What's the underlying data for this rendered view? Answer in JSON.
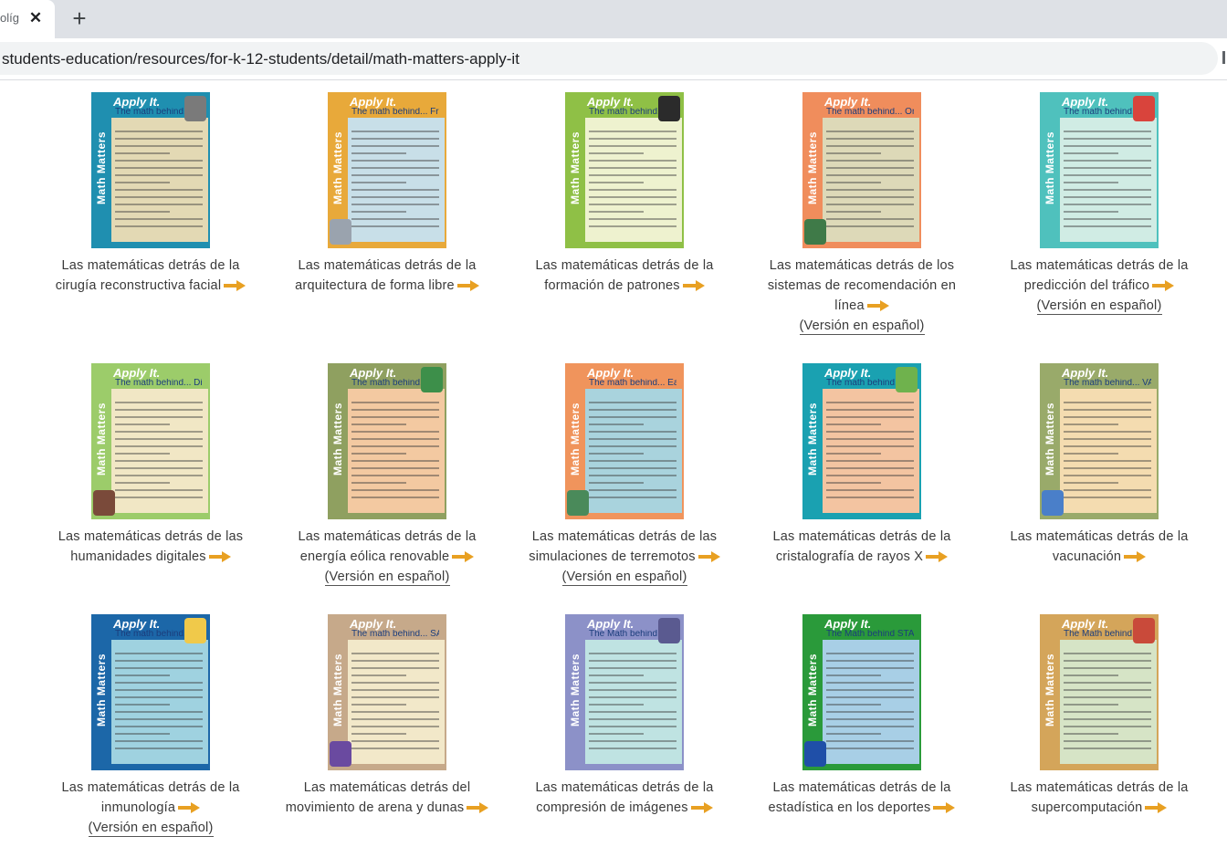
{
  "browser": {
    "tab_title": "olíg",
    "tab_close_glyph": "✕",
    "new_tab_glyph": "+",
    "url": "students-education/resources/for-k-12-students/detail/math-matters-apply-it"
  },
  "poster_text": {
    "side": "Math Matters",
    "apply": "Apply It."
  },
  "colors": {
    "arrow": "#e8a022",
    "link_text": "#3a3a3a"
  },
  "cards": [
    {
      "line1": "Las matemáticas detrás de la",
      "line2": "cirugía reconstructiva facial",
      "line3": "",
      "spanish": "",
      "poster": "The math behind... Facial Reconstructive Surgery",
      "strip": "#1f8fb0",
      "bg": "#e3d9b4",
      "deco": "#7a7a7a"
    },
    {
      "line1": "Las matemáticas detrás de la",
      "line2": "arquitectura de forma libre",
      "line3": "",
      "spanish": "",
      "poster": "The math behind... Freeform Architecture",
      "strip": "#e8a93a",
      "bg": "#c8dfe8",
      "deco": "#9aa3ae"
    },
    {
      "line1": "Las matemáticas detrás de la",
      "line2": "formación de patrones",
      "line3": "",
      "spanish": "",
      "poster": "The math behind... Pattern Formation",
      "strip": "#8fc046",
      "bg": "#eef2cf",
      "deco": "#2b2b2b"
    },
    {
      "line1": "Las matemáticas detrás de los",
      "line2": "sistemas de recomendación en",
      "line3": "línea",
      "spanish": "(Versión en español)",
      "poster": "The math behind... Online Recommender Systems",
      "strip": "#f08d5c",
      "bg": "#ddd9b8",
      "deco": "#3f7a48"
    },
    {
      "line1": "Las matemáticas detrás de la",
      "line2": "predicción del tráfico",
      "line3": "",
      "spanish": "(Versión en español)",
      "poster": "The math behind... Predicting Traffic",
      "strip": "#4fc1bd",
      "bg": "#d0ece4",
      "deco": "#d9443c"
    },
    {
      "line1": "Las matemáticas detrás de las",
      "line2": "humanidades digitales",
      "line3": "",
      "spanish": "",
      "poster": "The math behind... Digital Humanities",
      "strip": "#9ccc6a",
      "bg": "#f1e7c5",
      "deco": "#7a4a3a"
    },
    {
      "line1": "Las matemáticas detrás de la",
      "line2": "energía eólica renovable",
      "line3": "",
      "spanish": "(Versión en español)",
      "poster": "The math behind... Renewable Wind Energy",
      "strip": "#8fa060",
      "bg": "#f3c9a1",
      "deco": "#3d8f4a"
    },
    {
      "line1": "Las matemáticas detrás de las",
      "line2": "simulaciones de terremotos",
      "line3": "",
      "spanish": "(Versión en español)",
      "poster": "The math behind... Earthquake Simulations",
      "strip": "#f0945c",
      "bg": "#a9d3dd",
      "deco": "#4a8a5a"
    },
    {
      "line1": "Las matemáticas detrás de la",
      "line2": "cristalografía de rayos X",
      "line3": "",
      "spanish": "",
      "poster": "The math behind... X-Ray Crystallography",
      "strip": "#1aa1b1",
      "bg": "#f3c4a1",
      "deco": "#6fb24d"
    },
    {
      "line1": "Las matemáticas detrás de la",
      "line2": "vacunación",
      "line3": "",
      "spanish": "",
      "poster": "The math behind... VACCINATION",
      "strip": "#99aa6a",
      "bg": "#f4dcb0",
      "deco": "#4a7fc9"
    },
    {
      "line1": "Las matemáticas detrás de la",
      "line2": "inmunología",
      "line3": "",
      "spanish": "(Versión en español)",
      "poster": "The math behind... IMMUNOLOGY",
      "strip": "#1c67a8",
      "bg": "#9fd2e0",
      "deco": "#f0c94a"
    },
    {
      "line1": "Las matemáticas detrás del",
      "line2": "movimiento de arena y dunas",
      "line3": "",
      "spanish": "",
      "poster": "The math behind... SAND & DUNE MOTION",
      "strip": "#c6a98a",
      "bg": "#f2e8c9",
      "deco": "#6a4aa0"
    },
    {
      "line1": "Las matemáticas detrás de la",
      "line2": "compresión de imágenes",
      "line3": "",
      "spanish": "",
      "poster": "The Math behind IMAGE COMPRESSION",
      "strip": "#8c91c8",
      "bg": "#bfe3e2",
      "deco": "#5a5a90"
    },
    {
      "line1": "Las matemáticas detrás de la",
      "line2": "estadística en los deportes",
      "line3": "",
      "spanish": "",
      "poster": "The Math behind STATISTICS IN SPORTS",
      "strip": "#2a9a3a",
      "bg": "#a8cfe6",
      "deco": "#1f4fa8"
    },
    {
      "line1": "Las matemáticas detrás de la",
      "line2": "supercomputación",
      "line3": "",
      "spanish": "",
      "poster": "The Math behind SUPERCOMPUTING...",
      "strip": "#d4a55a",
      "bg": "#d6e4c6",
      "deco": "#c94a3a"
    }
  ]
}
